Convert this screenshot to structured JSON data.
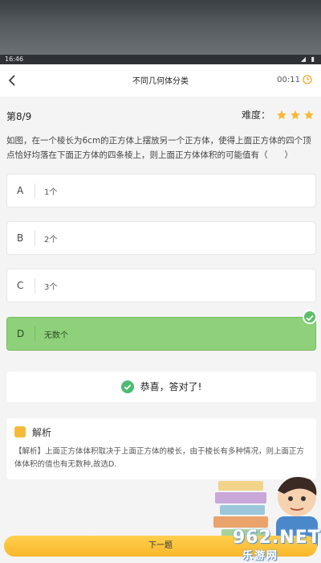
{
  "status_bar": {
    "time": "16:46",
    "icons": "◢ ▮"
  },
  "header": {
    "title": "不同几何体分类",
    "timer": "00:11"
  },
  "question_meta": {
    "index": "第8/9",
    "difficulty_label": "难度：",
    "difficulty_stars": 3
  },
  "question": {
    "text": "如图，在一个棱长为6cm的正方体上摆放另一个正方体，使得上面正方体的四个顶点恰好均落在下面正方体的四条棱上，则上面正方体体积的可能值有（　　）"
  },
  "options": [
    {
      "letter": "A",
      "text": "1个"
    },
    {
      "letter": "B",
      "text": "2个"
    },
    {
      "letter": "C",
      "text": "3个"
    },
    {
      "letter": "D",
      "text": "无数个"
    }
  ],
  "result": {
    "text": "恭喜，答对了!"
  },
  "analysis": {
    "title": "解析",
    "text": "【解析】上面正方体体积取决于上面正方体的棱长，由于棱长有多种情况，则上面正方体体积的值也有无数种,故选D."
  },
  "footer": {
    "next_label": "下一题"
  },
  "watermark": {
    "line1": "962.NET",
    "line2": "乐游网"
  },
  "colors": {
    "accent": "#f9b72b",
    "correct": "#8fd07a",
    "star": "#f5b93a"
  }
}
